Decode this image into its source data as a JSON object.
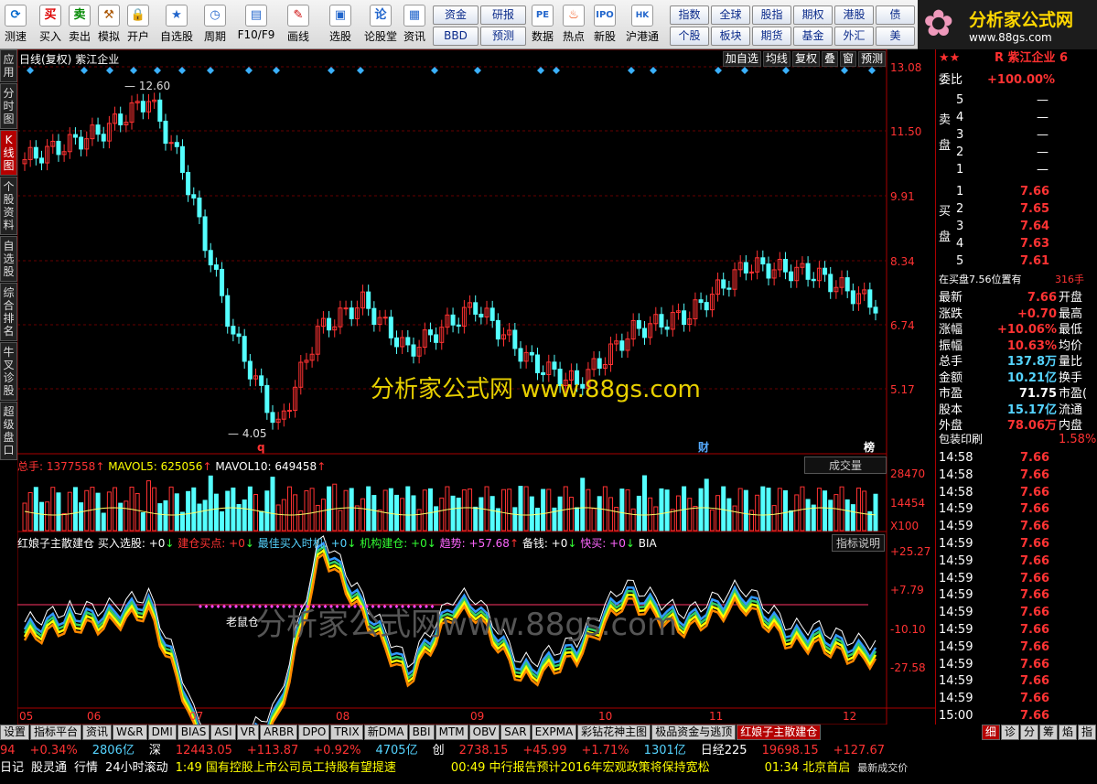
{
  "toolbar": {
    "buttons": [
      "测速",
      "买入",
      "卖出",
      "模拟",
      "开户",
      "自选股",
      "周期",
      "F10/F9",
      "画线",
      "选股",
      "论股堂",
      "资讯",
      "数据",
      "热点",
      "新股",
      "沪港通"
    ],
    "buy_icon": "买",
    "sell_icon": "卖",
    "grid": [
      "资金",
      "研报",
      "指数",
      "全球",
      "股指",
      "期权",
      "港股",
      "债",
      "BBD",
      "预测",
      "个股",
      "板块",
      "期货",
      "基金",
      "外汇",
      "美"
    ],
    "logo_title": "分析家公式网",
    "logo_url": "www.88gs.com"
  },
  "side_tabs": [
    "应用",
    "分时图",
    "K线图",
    "个股资料",
    "自选股",
    "综合排名",
    "牛叉诊股",
    "超级盘口"
  ],
  "chart": {
    "title": "日线(复权)",
    "stock_name": "紫江企业",
    "header_buttons": [
      "加自选",
      "均线",
      "复权",
      "叠",
      "窗",
      "预测"
    ],
    "watermark1": "分析家公式网 www.88gs.com",
    "watermark2": "分析家公式网www.88gs.com",
    "price_ticks": [
      "13.08",
      "11.50",
      "9.91",
      "8.34",
      "6.74",
      "5.17"
    ],
    "high_label": "12.60",
    "low_label": "4.05",
    "markers": [
      "q",
      "财",
      "榜"
    ],
    "vol_header": {
      "total": "总手: 1377558",
      "ma5": "MAVOL5: 625056",
      "ma10": "MAVOL10: 649458",
      "button": "成交量"
    },
    "vol_ticks": [
      "28470",
      "14454",
      "X100"
    ],
    "ind_header": {
      "name": "红娘子主散建仓",
      "a": "买入选股: +0",
      "b": "建仓买点: +0",
      "c": "最佳买入时机: +0",
      "d": "机构建仓: +0",
      "e": "趋势: +57.68",
      "f": "备钱: +0",
      "g": "快买: +0",
      "h": "BIA",
      "button": "指标说明"
    },
    "ind_ticks": [
      "+25.27",
      "+7.79",
      "-10.10",
      "-27.58"
    ],
    "ind_label": "老鼠仓",
    "months": [
      "05",
      "06",
      "07",
      "08",
      "09",
      "10",
      "11",
      "12"
    ],
    "colors": {
      "up": "#ff3232",
      "down": "#54ffff",
      "bg": "#000000"
    }
  },
  "right_panel": {
    "title": "R 紫江企业 6",
    "weibi_label": "委比",
    "weibi_value": "+100.00%",
    "sell_label": "卖盘",
    "buy_label": "买盘",
    "sell": [
      {
        "n": "5",
        "p": "—"
      },
      {
        "n": "4",
        "p": "—"
      },
      {
        "n": "3",
        "p": "—"
      },
      {
        "n": "2",
        "p": "—"
      },
      {
        "n": "1",
        "p": "—"
      }
    ],
    "buy": [
      {
        "n": "1",
        "p": "7.66"
      },
      {
        "n": "2",
        "p": "7.65"
      },
      {
        "n": "3",
        "p": "7.64"
      },
      {
        "n": "4",
        "p": "7.63"
      },
      {
        "n": "5",
        "p": "7.61"
      }
    ],
    "zaimai": "在买盘7.56位置有",
    "zaimai_val": "316手",
    "stats": [
      {
        "l": "最新",
        "v": "7.66",
        "r": "开盘"
      },
      {
        "l": "涨跌",
        "v": "+0.70",
        "r": "最高"
      },
      {
        "l": "涨幅",
        "v": "+10.06%",
        "r": "最低"
      },
      {
        "l": "振幅",
        "v": "10.63%",
        "r": "均价"
      },
      {
        "l": "总手",
        "v": "137.8万",
        "r": "量比"
      },
      {
        "l": "金额",
        "v": "10.21亿",
        "r": "换手"
      },
      {
        "l": "市盈",
        "v": "71.75",
        "r": "市盈("
      },
      {
        "l": "股本",
        "v": "15.17亿",
        "r": "流通"
      },
      {
        "l": "外盘",
        "v": "78.06万",
        "r": "内盘"
      }
    ],
    "sector": "包装印刷",
    "sector_val": "1.58%",
    "ticks": [
      {
        "t": "14:58",
        "p": "7.66"
      },
      {
        "t": "14:58",
        "p": "7.66"
      },
      {
        "t": "14:58",
        "p": "7.66"
      },
      {
        "t": "14:59",
        "p": "7.66"
      },
      {
        "t": "14:59",
        "p": "7.66"
      },
      {
        "t": "14:59",
        "p": "7.66"
      },
      {
        "t": "14:59",
        "p": "7.66"
      },
      {
        "t": "14:59",
        "p": "7.66"
      },
      {
        "t": "14:59",
        "p": "7.66"
      },
      {
        "t": "14:59",
        "p": "7.66"
      },
      {
        "t": "14:59",
        "p": "7.66"
      },
      {
        "t": "14:59",
        "p": "7.66"
      },
      {
        "t": "14:59",
        "p": "7.66"
      },
      {
        "t": "14:59",
        "p": "7.66"
      },
      {
        "t": "14:59",
        "p": "7.66"
      },
      {
        "t": "15:00",
        "p": "7.66"
      }
    ]
  },
  "bottom_tabs": [
    "设置",
    "指标平台",
    "资讯",
    "W&R",
    "DMI",
    "BIAS",
    "ASI",
    "VR",
    "ARBR",
    "DPO",
    "TRIX",
    "新DMA",
    "BBI",
    "MTM",
    "OBV",
    "SAR",
    "EXPMA",
    "彩钻花神主图",
    "极品资金与逃顶",
    "红娘子主散建仓"
  ],
  "bottom_right_tabs": [
    "细",
    "诊",
    "分",
    "筹",
    "焰",
    "指"
  ],
  "status1": [
    {
      "t": "94",
      "c": "red"
    },
    {
      "t": "+0.34%",
      "c": "red"
    },
    {
      "t": "2806亿",
      "c": "cyan"
    },
    {
      "t": "深",
      "c": "white"
    },
    {
      "t": "12443.05",
      "c": "red"
    },
    {
      "t": "+113.87",
      "c": "red"
    },
    {
      "t": "+0.92%",
      "c": "red"
    },
    {
      "t": "4705亿",
      "c": "cyan"
    },
    {
      "t": "创",
      "c": "white"
    },
    {
      "t": "2738.15",
      "c": "red"
    },
    {
      "t": "+45.99",
      "c": "red"
    },
    {
      "t": "+1.71%",
      "c": "red"
    },
    {
      "t": "1301亿",
      "c": "cyan"
    },
    {
      "t": "日经225",
      "c": "white"
    },
    {
      "t": "19698.15",
      "c": "red"
    },
    {
      "t": "+127.67",
      "c": "red"
    }
  ],
  "status2": {
    "tabs": [
      "日记",
      "股灵通",
      "行情",
      "24小时滚动"
    ],
    "news1": "1:49 国有控股上市公司员工持股有望提速",
    "news2": "00:49 中行报告预计2016年宏观政策将保持宽松",
    "news3": "01:34 北京首启",
    "footer": "最新成交价"
  }
}
